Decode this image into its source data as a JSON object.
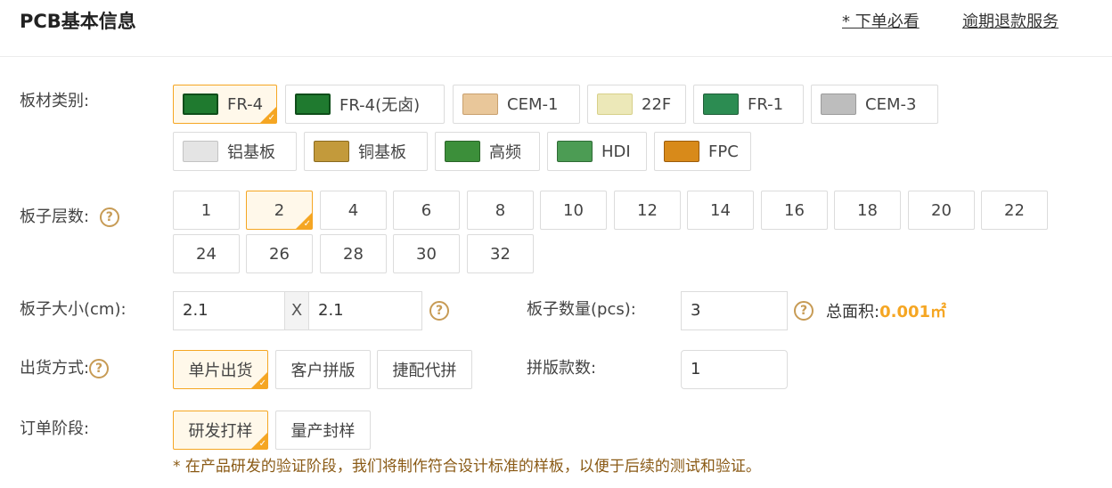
{
  "header": {
    "title": "PCB基本信息",
    "must_read": "* 下单必看",
    "refund": "逾期退款服务"
  },
  "material": {
    "label": "板材类别:",
    "options": [
      "FR-4",
      "FR-4(无卤)",
      "CEM-1",
      "22F",
      "FR-1",
      "CEM-3",
      "铝基板",
      "铜基板",
      "高频",
      "HDI",
      "FPC"
    ],
    "selected": "FR-4"
  },
  "layers": {
    "label": "板子层数:",
    "options": [
      "1",
      "2",
      "4",
      "6",
      "8",
      "10",
      "12",
      "14",
      "16",
      "18",
      "20",
      "22",
      "24",
      "26",
      "28",
      "30",
      "32"
    ],
    "selected": "2"
  },
  "size": {
    "label": "板子大小(cm):",
    "width": "2.1",
    "sep": "X",
    "height": "2.1"
  },
  "quantity": {
    "label": "板子数量(pcs):",
    "value": "3",
    "area_label": "总面积:",
    "area_value": "0.001㎡"
  },
  "shipping": {
    "label": "出货方式:",
    "options": [
      "单片出货",
      "客户拼版",
      "捷配代拼"
    ],
    "selected": "单片出货"
  },
  "panel": {
    "label": "拼版款数:",
    "value": "1"
  },
  "order_stage": {
    "label": "订单阶段:",
    "options": [
      "研发打样",
      "量产封样"
    ],
    "selected": "研发打样",
    "note": "* 在产品研发的验证阶段，我们将制作符合设计标准的样板，以便于后续的测试和验证。"
  },
  "icons": {
    "help": "question-circle-icon",
    "check": "check-icon"
  },
  "colors": {
    "accent": "#f5a623",
    "note": "#8a5a15",
    "help": "#c79b55"
  }
}
